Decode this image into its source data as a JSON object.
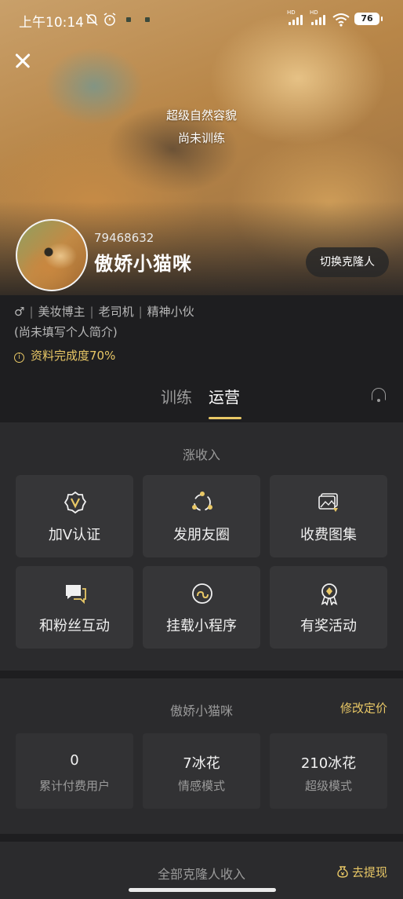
{
  "status_bar": {
    "time": "上午10:14",
    "battery": "76",
    "hd1": "HD",
    "hd2": "HD"
  },
  "hero": {
    "line1": "超级自然容貌",
    "line2": "尚未训练"
  },
  "profile": {
    "id": "79468632",
    "name": "傲娇小猫咪",
    "switch_label": "切换克隆人",
    "gender_icon": "♂",
    "tags": [
      "美妆博主",
      "老司机",
      "精神小伙"
    ],
    "bio": "(尚未填写个人简介)",
    "completion": "资料完成度70%"
  },
  "tabs": {
    "training": "训练",
    "operations": "运营"
  },
  "income": {
    "title": "涨收入",
    "cards": [
      {
        "label": "加V认证",
        "icon": "v-badge-icon"
      },
      {
        "label": "发朋友圈",
        "icon": "moments-icon"
      },
      {
        "label": "收费图集",
        "icon": "paid-gallery-icon"
      },
      {
        "label": "和粉丝互动",
        "icon": "chat-icon"
      },
      {
        "label": "挂载小程序",
        "icon": "mini-program-icon"
      },
      {
        "label": "有奖活动",
        "icon": "award-icon"
      }
    ]
  },
  "pricing": {
    "title": "傲娇小猫咪",
    "edit_label": "修改定价",
    "stats": [
      {
        "value": "0",
        "label": "累计付费用户"
      },
      {
        "value": "7冰花",
        "label": "情感模式"
      },
      {
        "value": "210冰花",
        "label": "超级模式"
      }
    ]
  },
  "all_income": {
    "title": "全部克隆人收入",
    "withdraw_label": "去提现"
  },
  "colors": {
    "accent": "#e9c866",
    "background": "#1e1e20",
    "panel": "#2b2b2d",
    "card": "#363638"
  }
}
